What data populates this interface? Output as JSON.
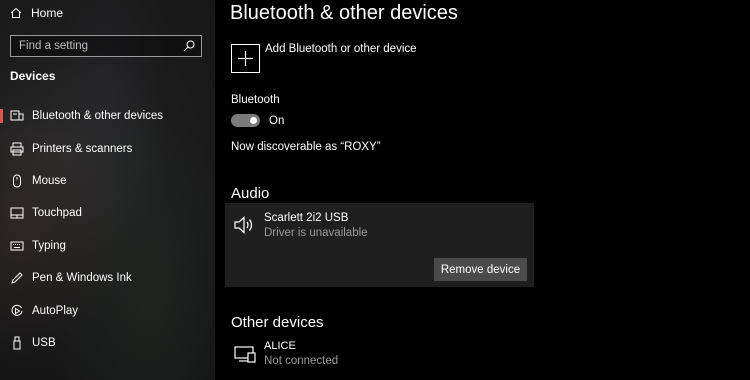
{
  "sidebar": {
    "home_label": "Home",
    "search_placeholder": "Find a setting",
    "section_title": "Devices",
    "items": [
      {
        "label": "Bluetooth & other devices",
        "icon": "bluetooth-devices-icon"
      },
      {
        "label": "Printers & scanners",
        "icon": "printer-icon"
      },
      {
        "label": "Mouse",
        "icon": "mouse-icon"
      },
      {
        "label": "Touchpad",
        "icon": "touchpad-icon"
      },
      {
        "label": "Typing",
        "icon": "keyboard-icon"
      },
      {
        "label": "Pen & Windows Ink",
        "icon": "pen-icon"
      },
      {
        "label": "AutoPlay",
        "icon": "autoplay-icon"
      },
      {
        "label": "USB",
        "icon": "usb-icon"
      }
    ],
    "accent_color": "#d45a5a"
  },
  "main": {
    "title": "Bluetooth & other devices",
    "add_device_label": "Add Bluetooth or other device",
    "bluetooth_label": "Bluetooth",
    "bluetooth_toggle": "On",
    "discoverable_text": "Now discoverable as “ROXY”",
    "audio_heading": "Audio",
    "audio_device": {
      "name": "Scarlett 2i2 USB",
      "status": "Driver is unavailable",
      "remove_label": "Remove device",
      "icon": "speaker-icon"
    },
    "other_heading": "Other devices",
    "other_device": {
      "name": "ALICE",
      "status": "Not connected",
      "icon": "computer-icon"
    }
  }
}
